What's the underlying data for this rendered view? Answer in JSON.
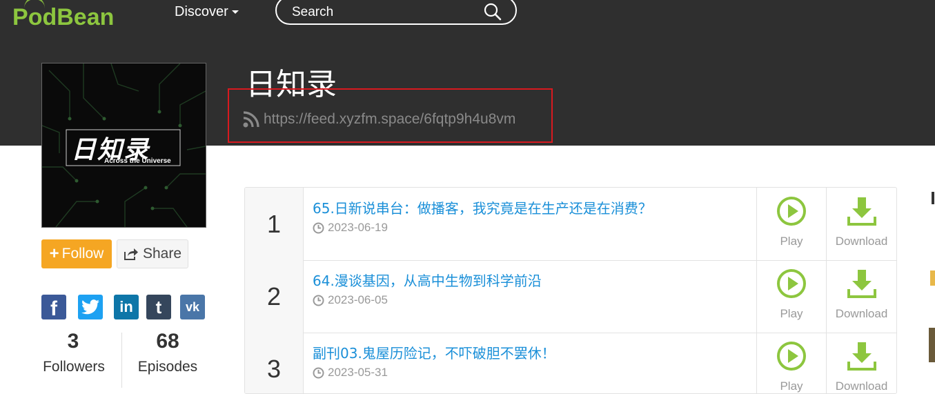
{
  "header": {
    "logo_text": "PodBean",
    "nav_discover": "Discover",
    "search_placeholder": "Search"
  },
  "podcast": {
    "title": "日知录",
    "feed_url": "https://feed.xyzfm.space/6fqtp9h4u8vm",
    "cover_title": "日知录",
    "cover_subtitle": "Across the Universe"
  },
  "actions": {
    "follow_label": "Follow",
    "share_label": "Share"
  },
  "social": [
    "facebook-icon",
    "twitter-icon",
    "linkedin-icon",
    "tumblr-icon",
    "vk-icon"
  ],
  "stats": {
    "followers_count": "3",
    "followers_label": "Followers",
    "episodes_count": "68",
    "episodes_label": "Episodes"
  },
  "episodes": [
    {
      "number": "1",
      "title": "65.日新说串台：做播客，我究竟是在生产还是在消费？",
      "date": "2023-06-19",
      "play_label": "Play",
      "download_label": "Download"
    },
    {
      "number": "2",
      "title": "64.漫谈基因，从高中生物到科学前沿",
      "date": "2023-06-05",
      "play_label": "Play",
      "download_label": "Download"
    },
    {
      "number": "3",
      "title": "副刊03.鬼屋历险记，不吓破胆不罢休！",
      "date": "2023-05-31",
      "play_label": "Play",
      "download_label": "Download"
    }
  ],
  "colors": {
    "brand_green": "#8dc63f",
    "header_dark": "#2f2f2f",
    "follow_orange": "#f5a623",
    "link_blue": "#1a8fd8",
    "highlight_red": "#d9191f"
  }
}
